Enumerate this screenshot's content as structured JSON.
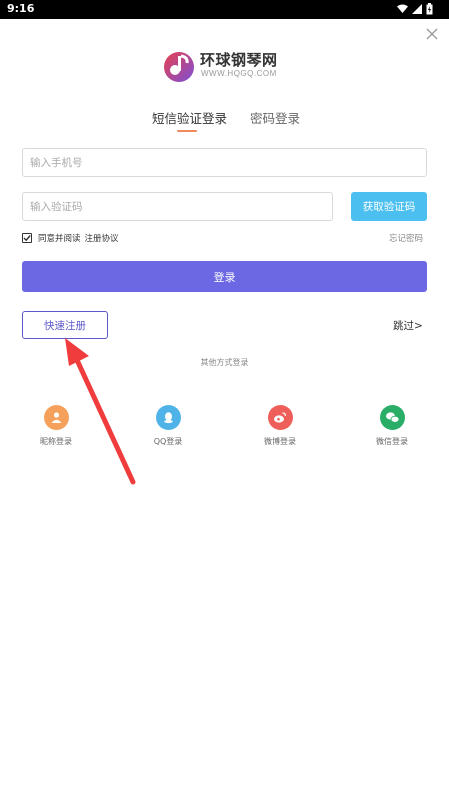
{
  "status_bar": {
    "time": "9:16"
  },
  "logo": {
    "brand": "环球钢琴网",
    "url": "WWW.HQGQ.COM"
  },
  "tabs": [
    {
      "label": "短信验证登录",
      "active": true
    },
    {
      "label": "密码登录",
      "active": false
    }
  ],
  "form": {
    "phone_placeholder": "输入手机号",
    "code_placeholder": "输入验证码",
    "get_code_label": "获取验证码",
    "agree_text": "同意并阅读",
    "agreement_link": "注册协议",
    "forgot_password": "忘记密码",
    "login_label": "登录",
    "register_label": "快速注册",
    "skip_label": "跳过>"
  },
  "other_login": {
    "title": "其他方式登录",
    "options": [
      {
        "label": "昵称登录",
        "icon": "user-icon",
        "color": "#f5a15c"
      },
      {
        "label": "QQ登录",
        "icon": "qq-icon",
        "color": "#4fb3e8"
      },
      {
        "label": "微博登录",
        "icon": "weibo-icon",
        "color": "#ef5f5a"
      },
      {
        "label": "微信登录",
        "icon": "wechat-icon",
        "color": "#2aae67"
      }
    ]
  },
  "colors": {
    "primary": "#6c68e3",
    "accent_blue": "#4bc0f0",
    "tab_underline": "#f08a5d",
    "arrow": "#f03c3c"
  }
}
